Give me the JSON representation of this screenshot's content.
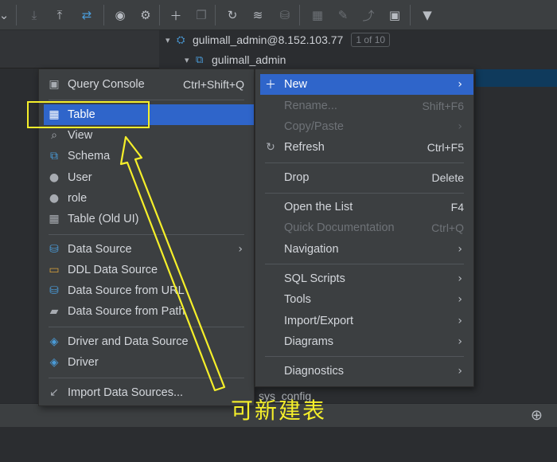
{
  "toolbar": {
    "icons": [
      "chevron-down-icon",
      "download-icon",
      "upload-icon",
      "compare-icon",
      "eye-icon",
      "gear-icon",
      "add-icon",
      "duplicate-icon",
      "refresh-icon",
      "schema-edit-icon",
      "database-icon",
      "table-icon",
      "edit-icon",
      "jump-icon",
      "query-console-icon",
      "filter-icon"
    ]
  },
  "tree": {
    "connection": "gulimall_admin@8.152.103.77",
    "connection_badge": "1 of 10",
    "schema": "gulimall_admin",
    "child": "sys_config"
  },
  "left_menu": {
    "items": [
      {
        "label": "Query Console",
        "shortcut": "Ctrl+Shift+Q",
        "icon": "query-console-icon"
      },
      {
        "label": "Table",
        "shortcut": "",
        "icon": "table-icon"
      },
      {
        "label": "View",
        "shortcut": "",
        "icon": "view-icon"
      },
      {
        "label": "Schema",
        "shortcut": "",
        "icon": "schema-icon"
      },
      {
        "label": "User",
        "shortcut": "",
        "icon": "user-icon"
      },
      {
        "label": "role",
        "shortcut": "",
        "icon": "role-icon"
      },
      {
        "label": "Table (Old UI)",
        "shortcut": "",
        "icon": "table-old-icon"
      },
      {
        "label": "Data Source",
        "shortcut": "",
        "icon": "data-source-icon"
      },
      {
        "label": "DDL Data Source",
        "shortcut": "",
        "icon": "ddl-icon"
      },
      {
        "label": "Data Source from URL",
        "shortcut": "",
        "icon": "url-icon"
      },
      {
        "label": "Data Source from Path",
        "shortcut": "",
        "icon": "folder-icon"
      },
      {
        "label": "Driver and Data Source",
        "shortcut": "",
        "icon": "driver-icon"
      },
      {
        "label": "Driver",
        "shortcut": "",
        "icon": "driver-icon"
      },
      {
        "label": "Import Data Sources...",
        "shortcut": "",
        "icon": "import-icon"
      }
    ]
  },
  "right_menu": {
    "items": [
      {
        "label": "New",
        "shortcut": ""
      },
      {
        "label": "Rename...",
        "shortcut": "Shift+F6"
      },
      {
        "label": "Copy/Paste",
        "shortcut": ""
      },
      {
        "label": "Refresh",
        "shortcut": "Ctrl+F5"
      },
      {
        "label": "Drop",
        "shortcut": "Delete"
      },
      {
        "label": "Open the List",
        "shortcut": "F4"
      },
      {
        "label": "Quick Documentation",
        "shortcut": "Ctrl+Q"
      },
      {
        "label": "Navigation",
        "shortcut": ""
      },
      {
        "label": "SQL Scripts",
        "shortcut": ""
      },
      {
        "label": "Tools",
        "shortcut": ""
      },
      {
        "label": "Import/Export",
        "shortcut": ""
      },
      {
        "label": "Diagrams",
        "shortcut": ""
      },
      {
        "label": "Diagnostics",
        "shortcut": ""
      }
    ]
  },
  "annotation": {
    "text": "可新建表",
    "color": "#f5ef2a"
  },
  "colors": {
    "selection": "#2f65ca",
    "menu_bg": "#3c3f41",
    "window_bg": "#2b2d30"
  }
}
